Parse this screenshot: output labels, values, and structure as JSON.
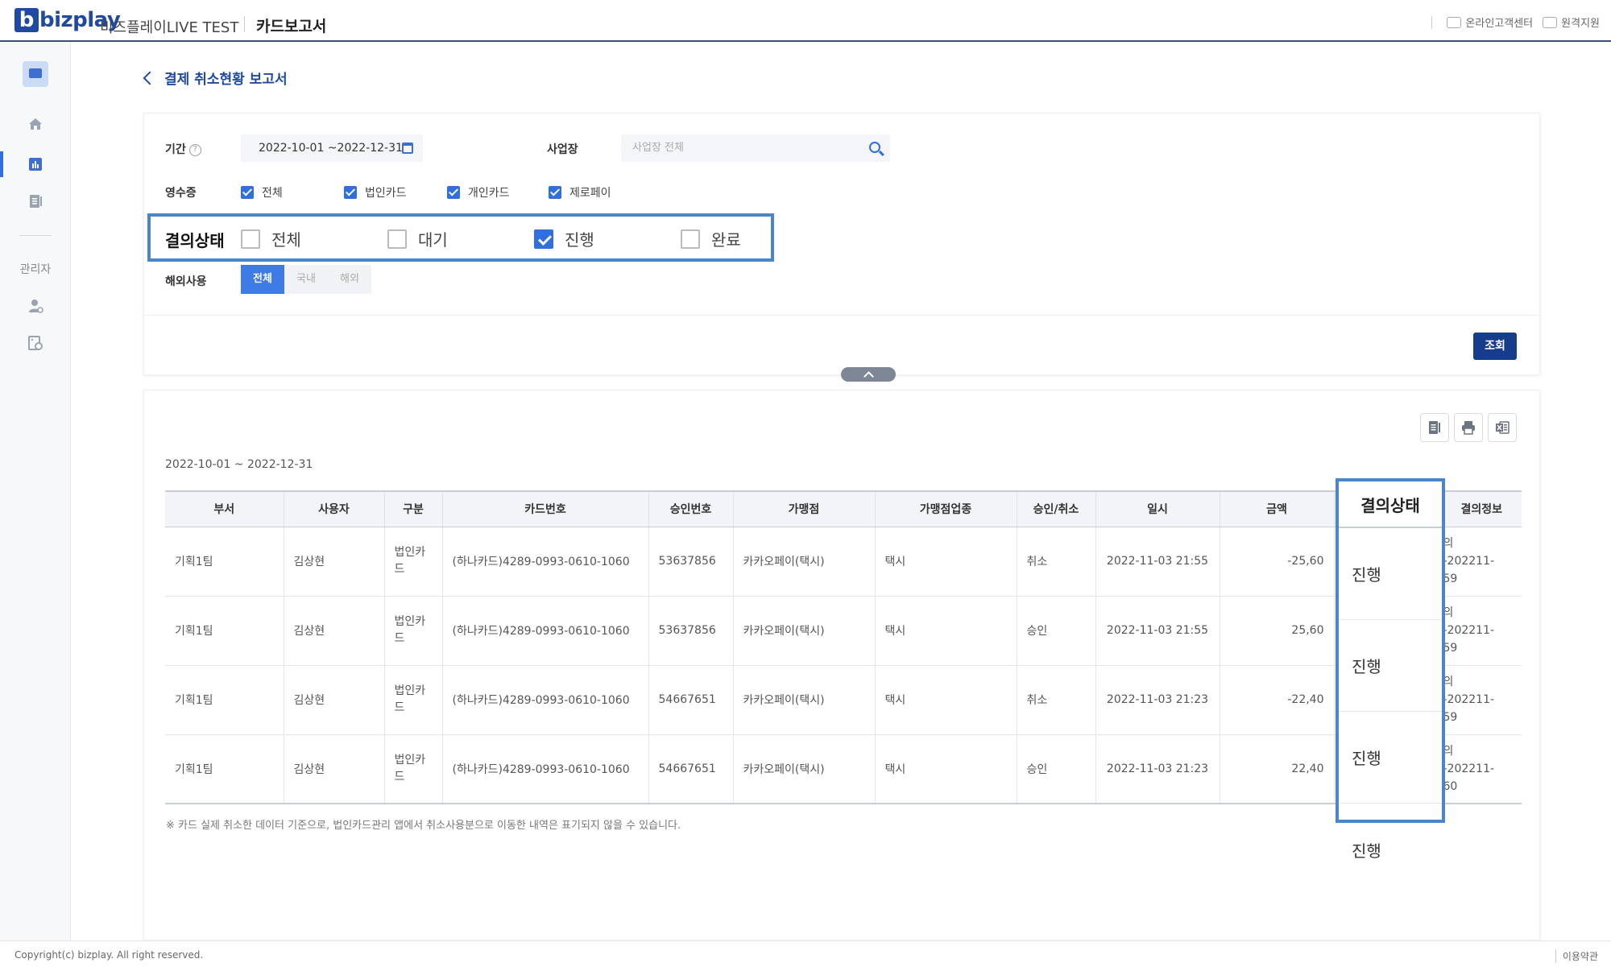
{
  "header": {
    "logo_text": "bizplay",
    "app_title": "비즈플레이LIVE TEST",
    "section_title": "카드보고서",
    "links": [
      "온라인고객센터",
      "원격지원"
    ]
  },
  "sidebar": {
    "admin_label": "관리자",
    "icons": [
      "profile-icon",
      "home-icon",
      "report-icon",
      "document-icon",
      "user-settings-icon",
      "admin-report-icon"
    ]
  },
  "page": {
    "title": "결제 취소현황 보고서"
  },
  "filters": {
    "period_label": "기간",
    "period_value": "2022-10-01 ~2022-12-31",
    "site_label": "사업장",
    "site_placeholder": "사업장 전체",
    "receipt_label": "영수증",
    "receipt_options": [
      "전체",
      "법인카드",
      "개인카드",
      "제로페이"
    ],
    "status_label": "결의상태",
    "status_options": [
      {
        "label": "전체",
        "checked": false
      },
      {
        "label": "대기",
        "checked": false
      },
      {
        "label": "진행",
        "checked": true
      },
      {
        "label": "완료",
        "checked": false
      }
    ],
    "overseas_label": "해외사용",
    "overseas_options": [
      "전체",
      "국내",
      "해외"
    ],
    "overseas_selected": "전체",
    "search_button": "조회"
  },
  "results": {
    "period_text": "2022-10-01 ~ 2022-12-31",
    "columns": [
      "부서",
      "사용자",
      "구분",
      "카드번호",
      "승인번호",
      "가맹점",
      "가맹점업종",
      "승인/취소",
      "일시",
      "금액",
      "결의상태",
      "결의정보"
    ],
    "rows": [
      {
        "dept": "기획1팀",
        "user": "김상현",
        "type": "법인카드",
        "card": "(하나카드)4289-0993-0610-1060",
        "approval_no": "53637856",
        "merchant": "카카오페이(택시)",
        "category": "택시",
        "approve_cancel": "취소",
        "datetime": "2022-11-03 21:55",
        "amount": "-25,60",
        "status": "진행",
        "info": "의\n-202211-\n59"
      },
      {
        "dept": "기획1팀",
        "user": "김상현",
        "type": "법인카드",
        "card": "(하나카드)4289-0993-0610-1060",
        "approval_no": "53637856",
        "merchant": "카카오페이(택시)",
        "category": "택시",
        "approve_cancel": "승인",
        "datetime": "2022-11-03 21:55",
        "amount": "25,60",
        "status": "진행",
        "info": "의\n-202211-\n59"
      },
      {
        "dept": "기획1팀",
        "user": "김상현",
        "type": "법인카드",
        "card": "(하나카드)4289-0993-0610-1060",
        "approval_no": "54667651",
        "merchant": "카카오페이(택시)",
        "category": "택시",
        "approve_cancel": "취소",
        "datetime": "2022-11-03 21:23",
        "amount": "-22,40",
        "status": "진행",
        "info": "의\n-202211-\n59"
      },
      {
        "dept": "기획1팀",
        "user": "김상현",
        "type": "법인카드",
        "card": "(하나카드)4289-0993-0610-1060",
        "approval_no": "54667651",
        "merchant": "카카오페이(택시)",
        "category": "택시",
        "approve_cancel": "승인",
        "datetime": "2022-11-03 21:23",
        "amount": "22,40",
        "status": "진행",
        "info": "의\n-202211-\n60"
      }
    ],
    "note": "※ 카드 실제 취소한 데이터 기준으로, 법인카드관리 앱에서 취소사용분으로 이동한 내역은 표기되지 않을 수 있습니다."
  },
  "footer": {
    "copyright": "Copyright(c) bizplay. All right reserved.",
    "terms": "이용약관"
  },
  "colors": {
    "brand": "#1f4aa0",
    "accent": "#2f6fe0",
    "highlight_border": "#4a86c8",
    "search_button": "#183c8c"
  }
}
